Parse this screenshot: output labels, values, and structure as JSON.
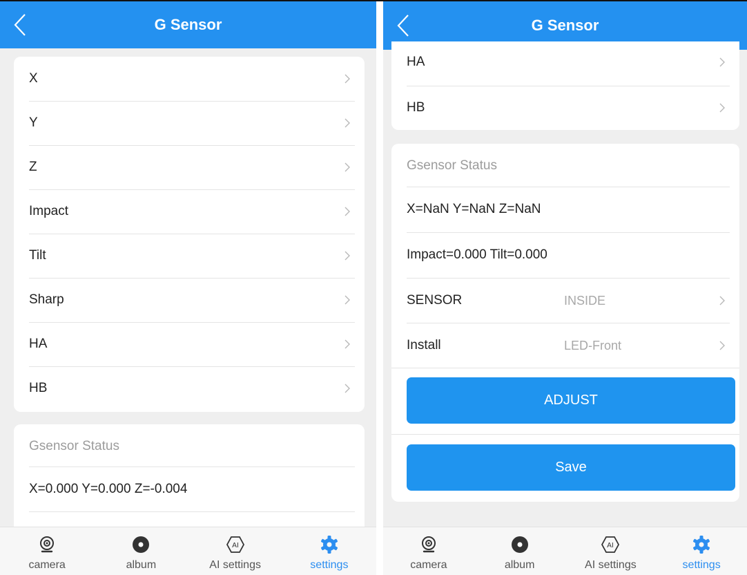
{
  "left": {
    "header": {
      "title": "G Sensor"
    },
    "menu": [
      {
        "label": "X"
      },
      {
        "label": "Y"
      },
      {
        "label": "Z"
      },
      {
        "label": "Impact"
      },
      {
        "label": "Tilt"
      },
      {
        "label": "Sharp"
      },
      {
        "label": "HA"
      },
      {
        "label": "HB"
      }
    ],
    "status": {
      "title": "Gsensor Status",
      "xyz": "X=0.000 Y=0.000 Z=-0.004"
    }
  },
  "right": {
    "header": {
      "title": "G Sensor"
    },
    "menu": [
      {
        "label": "HA"
      },
      {
        "label": "HB"
      }
    ],
    "status": {
      "title": "Gsensor Status",
      "xyz": "X=NaN Y=NaN Z=NaN",
      "impact_tilt": "Impact=0.000 Tilt=0.000",
      "sensor": {
        "label": "SENSOR",
        "value": "INSIDE"
      },
      "install": {
        "label": "Install",
        "value": "LED-Front"
      },
      "adjust_label": "ADJUST",
      "save_label": "Save"
    }
  },
  "tabbar": [
    {
      "label": "camera",
      "icon": "camera-icon"
    },
    {
      "label": "album",
      "icon": "album-icon"
    },
    {
      "label": "AI settings",
      "icon": "ai-icon"
    },
    {
      "label": "settings",
      "icon": "gear-icon",
      "active": true
    }
  ],
  "colors": {
    "primary": "#2491f0",
    "button": "#1f94ef",
    "background": "#efefef",
    "active_tab": "#2c8ef0"
  }
}
